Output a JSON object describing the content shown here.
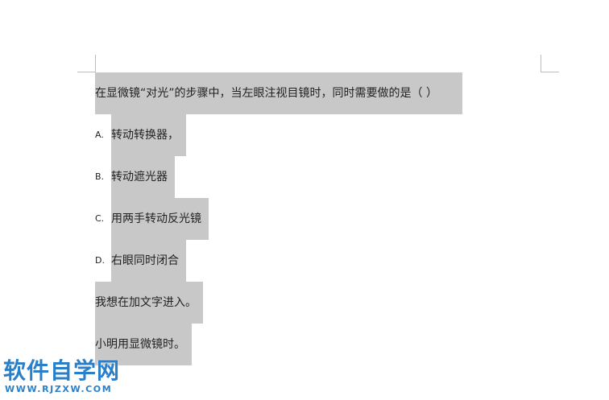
{
  "question": "在显微镜“对光”的步骤中，当左眼注视目镜时，同时需要做的是（    ）",
  "options": [
    {
      "letter": "A.",
      "text": "转动转换器，"
    },
    {
      "letter": "B.",
      "text": "转动遮光器"
    },
    {
      "letter": "C.",
      "text": "用两手转动反光镜"
    },
    {
      "letter": "D.",
      "text": "右眼同时闭合"
    }
  ],
  "extra_lines": [
    "我想在加文字进入。",
    "小明用显微镜时。"
  ],
  "watermark": {
    "title": "软件自学网",
    "url": "WWW.RJZXW.COM"
  },
  "colors": {
    "selection": "#c8c8c8",
    "watermark": "#2b7fc9"
  }
}
